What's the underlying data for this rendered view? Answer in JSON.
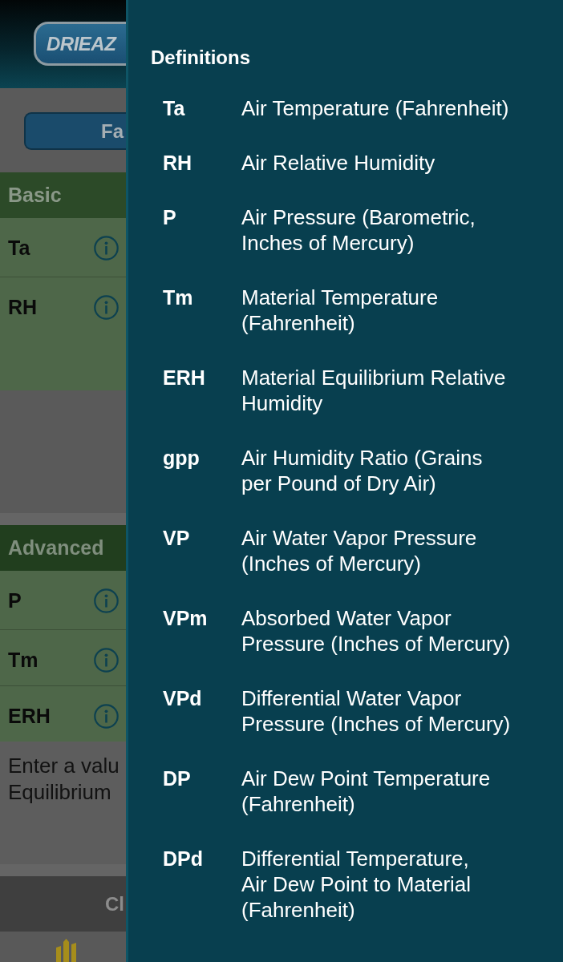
{
  "header": {
    "logo": "DRIEAZ"
  },
  "unit_button": {
    "label": "Fa"
  },
  "sections": [
    {
      "title": "Basic",
      "rows": [
        {
          "label": "Ta"
        },
        {
          "label": "RH"
        }
      ]
    },
    {
      "title": "Advanced",
      "rows": [
        {
          "label": "P"
        },
        {
          "label": "Tm"
        },
        {
          "label": "ERH"
        }
      ]
    }
  ],
  "note": "Enter a valu\nEquilibrium",
  "action_button": {
    "label": "Cl"
  },
  "drawer": {
    "title": "Definitions",
    "terms": [
      {
        "abbr": "Ta",
        "definition": "Air Temperature (Fahrenheit)"
      },
      {
        "abbr": "RH",
        "definition": "Air Relative Humidity"
      },
      {
        "abbr": "P",
        "definition": "Air Pressure (Barometric,\nInches of Mercury)"
      },
      {
        "abbr": "Tm",
        "definition": "Material Temperature\n(Fahrenheit)"
      },
      {
        "abbr": "ERH",
        "definition": "Material Equilibrium Relative\nHumidity"
      },
      {
        "abbr": "gpp",
        "definition": "Air Humidity Ratio (Grains\nper Pound of Dry Air)"
      },
      {
        "abbr": "VP",
        "definition": "Air Water Vapor Pressure\n(Inches of Mercury)"
      },
      {
        "abbr": "VPm",
        "definition": "Absorbed Water Vapor\nPressure (Inches of Mercury)"
      },
      {
        "abbr": "VPd",
        "definition": "Differential Water Vapor\nPressure (Inches of Mercury)"
      },
      {
        "abbr": "DP",
        "definition": "Air Dew Point Temperature\n(Fahrenheit)"
      },
      {
        "abbr": "DPd",
        "definition": "Differential Temperature,\nAir Dew Point to Material\n(Fahrenheit)"
      }
    ]
  }
}
